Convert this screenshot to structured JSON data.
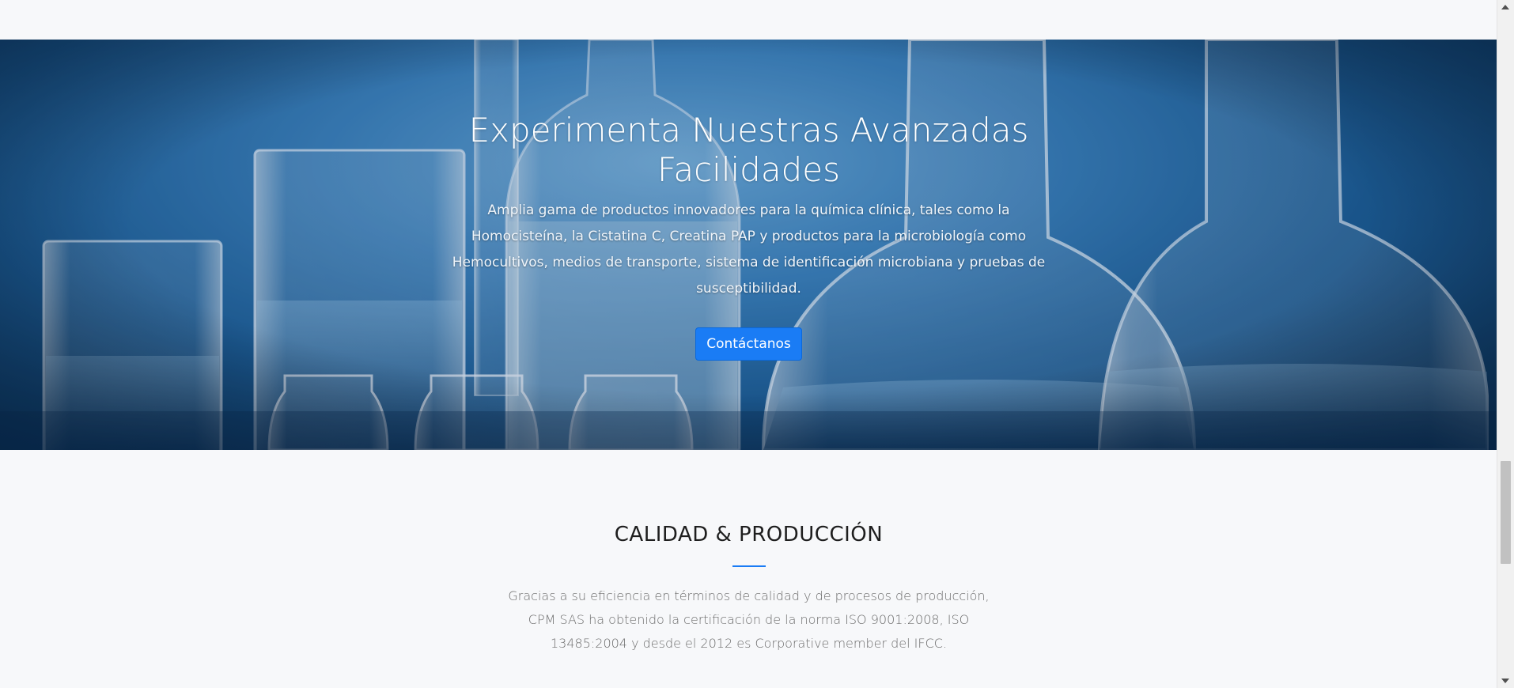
{
  "hero": {
    "title": "Experimenta Nuestras Avanzadas Facilidades",
    "text": "Amplia gama de productos innovadores para la química clínica, tales como la Homocisteína, la Cistatina C, Creatina PAP y productos para la microbiología como Hemocultivos, medios de transporte, sistema de identificación microbiana y pruebas de susceptibilidad.",
    "button_label": "Contáctanos",
    "background_image": "laboratory-glassware-photo"
  },
  "quality": {
    "title": "CALIDAD & PRODUCCIÓN",
    "text": "Gracias a su eficiencia en términos de calidad y de procesos de producción, CPM SAS ha obtenido la certificación de la norma ISO 9001:2008, ISO 13485:2004 y desde el 2012 es Corporative member del IFCC."
  },
  "colors": {
    "accent": "#1a7cf5",
    "page_background": "#f7f8fa",
    "hero_blue": "#1d5f98"
  },
  "icons": {
    "scroll_up": "chevron-up-icon",
    "scroll_down": "chevron-down-icon"
  }
}
